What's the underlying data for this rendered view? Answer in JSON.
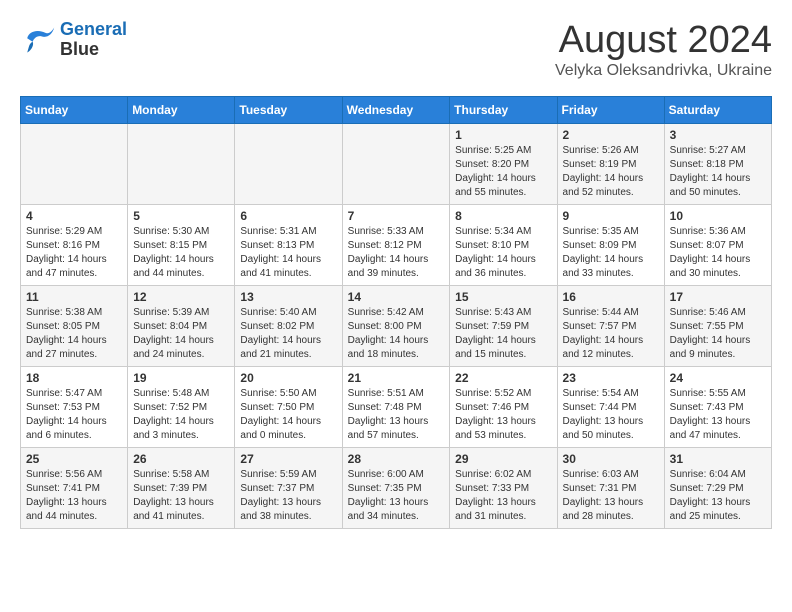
{
  "logo": {
    "line1": "General",
    "line2": "Blue"
  },
  "title": "August 2024",
  "subtitle": "Velyka Oleksandrivka, Ukraine",
  "headers": [
    "Sunday",
    "Monday",
    "Tuesday",
    "Wednesday",
    "Thursday",
    "Friday",
    "Saturday"
  ],
  "weeks": [
    [
      {
        "day": "",
        "info": ""
      },
      {
        "day": "",
        "info": ""
      },
      {
        "day": "",
        "info": ""
      },
      {
        "day": "",
        "info": ""
      },
      {
        "day": "1",
        "info": "Sunrise: 5:25 AM\nSunset: 8:20 PM\nDaylight: 14 hours\nand 55 minutes."
      },
      {
        "day": "2",
        "info": "Sunrise: 5:26 AM\nSunset: 8:19 PM\nDaylight: 14 hours\nand 52 minutes."
      },
      {
        "day": "3",
        "info": "Sunrise: 5:27 AM\nSunset: 8:18 PM\nDaylight: 14 hours\nand 50 minutes."
      }
    ],
    [
      {
        "day": "4",
        "info": "Sunrise: 5:29 AM\nSunset: 8:16 PM\nDaylight: 14 hours\nand 47 minutes."
      },
      {
        "day": "5",
        "info": "Sunrise: 5:30 AM\nSunset: 8:15 PM\nDaylight: 14 hours\nand 44 minutes."
      },
      {
        "day": "6",
        "info": "Sunrise: 5:31 AM\nSunset: 8:13 PM\nDaylight: 14 hours\nand 41 minutes."
      },
      {
        "day": "7",
        "info": "Sunrise: 5:33 AM\nSunset: 8:12 PM\nDaylight: 14 hours\nand 39 minutes."
      },
      {
        "day": "8",
        "info": "Sunrise: 5:34 AM\nSunset: 8:10 PM\nDaylight: 14 hours\nand 36 minutes."
      },
      {
        "day": "9",
        "info": "Sunrise: 5:35 AM\nSunset: 8:09 PM\nDaylight: 14 hours\nand 33 minutes."
      },
      {
        "day": "10",
        "info": "Sunrise: 5:36 AM\nSunset: 8:07 PM\nDaylight: 14 hours\nand 30 minutes."
      }
    ],
    [
      {
        "day": "11",
        "info": "Sunrise: 5:38 AM\nSunset: 8:05 PM\nDaylight: 14 hours\nand 27 minutes."
      },
      {
        "day": "12",
        "info": "Sunrise: 5:39 AM\nSunset: 8:04 PM\nDaylight: 14 hours\nand 24 minutes."
      },
      {
        "day": "13",
        "info": "Sunrise: 5:40 AM\nSunset: 8:02 PM\nDaylight: 14 hours\nand 21 minutes."
      },
      {
        "day": "14",
        "info": "Sunrise: 5:42 AM\nSunset: 8:00 PM\nDaylight: 14 hours\nand 18 minutes."
      },
      {
        "day": "15",
        "info": "Sunrise: 5:43 AM\nSunset: 7:59 PM\nDaylight: 14 hours\nand 15 minutes."
      },
      {
        "day": "16",
        "info": "Sunrise: 5:44 AM\nSunset: 7:57 PM\nDaylight: 14 hours\nand 12 minutes."
      },
      {
        "day": "17",
        "info": "Sunrise: 5:46 AM\nSunset: 7:55 PM\nDaylight: 14 hours\nand 9 minutes."
      }
    ],
    [
      {
        "day": "18",
        "info": "Sunrise: 5:47 AM\nSunset: 7:53 PM\nDaylight: 14 hours\nand 6 minutes."
      },
      {
        "day": "19",
        "info": "Sunrise: 5:48 AM\nSunset: 7:52 PM\nDaylight: 14 hours\nand 3 minutes."
      },
      {
        "day": "20",
        "info": "Sunrise: 5:50 AM\nSunset: 7:50 PM\nDaylight: 14 hours\nand 0 minutes."
      },
      {
        "day": "21",
        "info": "Sunrise: 5:51 AM\nSunset: 7:48 PM\nDaylight: 13 hours\nand 57 minutes."
      },
      {
        "day": "22",
        "info": "Sunrise: 5:52 AM\nSunset: 7:46 PM\nDaylight: 13 hours\nand 53 minutes."
      },
      {
        "day": "23",
        "info": "Sunrise: 5:54 AM\nSunset: 7:44 PM\nDaylight: 13 hours\nand 50 minutes."
      },
      {
        "day": "24",
        "info": "Sunrise: 5:55 AM\nSunset: 7:43 PM\nDaylight: 13 hours\nand 47 minutes."
      }
    ],
    [
      {
        "day": "25",
        "info": "Sunrise: 5:56 AM\nSunset: 7:41 PM\nDaylight: 13 hours\nand 44 minutes."
      },
      {
        "day": "26",
        "info": "Sunrise: 5:58 AM\nSunset: 7:39 PM\nDaylight: 13 hours\nand 41 minutes."
      },
      {
        "day": "27",
        "info": "Sunrise: 5:59 AM\nSunset: 7:37 PM\nDaylight: 13 hours\nand 38 minutes."
      },
      {
        "day": "28",
        "info": "Sunrise: 6:00 AM\nSunset: 7:35 PM\nDaylight: 13 hours\nand 34 minutes."
      },
      {
        "day": "29",
        "info": "Sunrise: 6:02 AM\nSunset: 7:33 PM\nDaylight: 13 hours\nand 31 minutes."
      },
      {
        "day": "30",
        "info": "Sunrise: 6:03 AM\nSunset: 7:31 PM\nDaylight: 13 hours\nand 28 minutes."
      },
      {
        "day": "31",
        "info": "Sunrise: 6:04 AM\nSunset: 7:29 PM\nDaylight: 13 hours\nand 25 minutes."
      }
    ]
  ]
}
